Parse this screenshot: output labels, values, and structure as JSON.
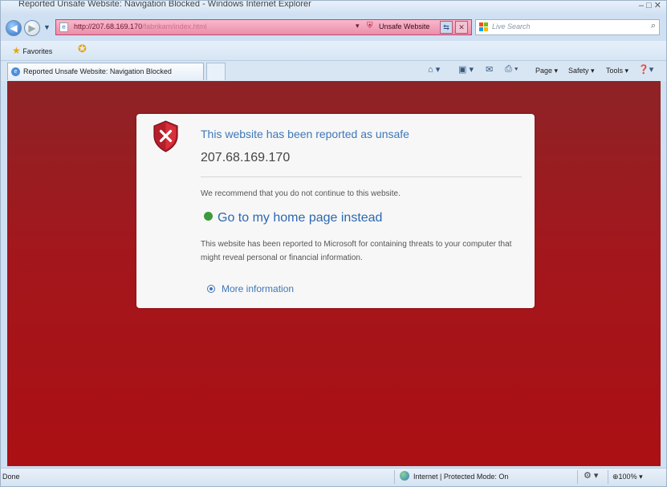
{
  "window": {
    "title": "Reported Unsafe Website: Navigation Blocked - Windows Internet Explorer",
    "controls": "– □ ✕"
  },
  "address_bar": {
    "url_host": "http://207.68.169.170",
    "url_path": "/fabrikam/index.html",
    "dropdown": "▾",
    "security_status": "Unsafe Website"
  },
  "search": {
    "placeholder": "Live Search",
    "flag_colors": [
      "#f25022",
      "#7fba00",
      "#00a4ef",
      "#ffb900"
    ]
  },
  "favorites_bar": {
    "favorites_label": "Favorites"
  },
  "tab": {
    "label": "Reported Unsafe Website: Navigation Blocked"
  },
  "command_bar": {
    "page": "Page ▾",
    "safety": "Safety ▾",
    "tools": "Tools ▾"
  },
  "warning": {
    "headline": "This website has been reported as unsafe",
    "address": "207.68.169.170",
    "recommendation": "We recommend that you do not continue to this website.",
    "home_link": "Go to my home page instead",
    "explanation": "This website has been reported to Microsoft for containing threats to your computer that might reveal personal or financial information.",
    "more_info": "More information"
  },
  "status_bar": {
    "status": "Done",
    "zone": "Internet | Protected Mode: On",
    "zoom": "100%"
  },
  "colors": {
    "page_background": "#a3171c",
    "unsafe_bar": "#ea8ea9",
    "link": "#2b68b0"
  }
}
